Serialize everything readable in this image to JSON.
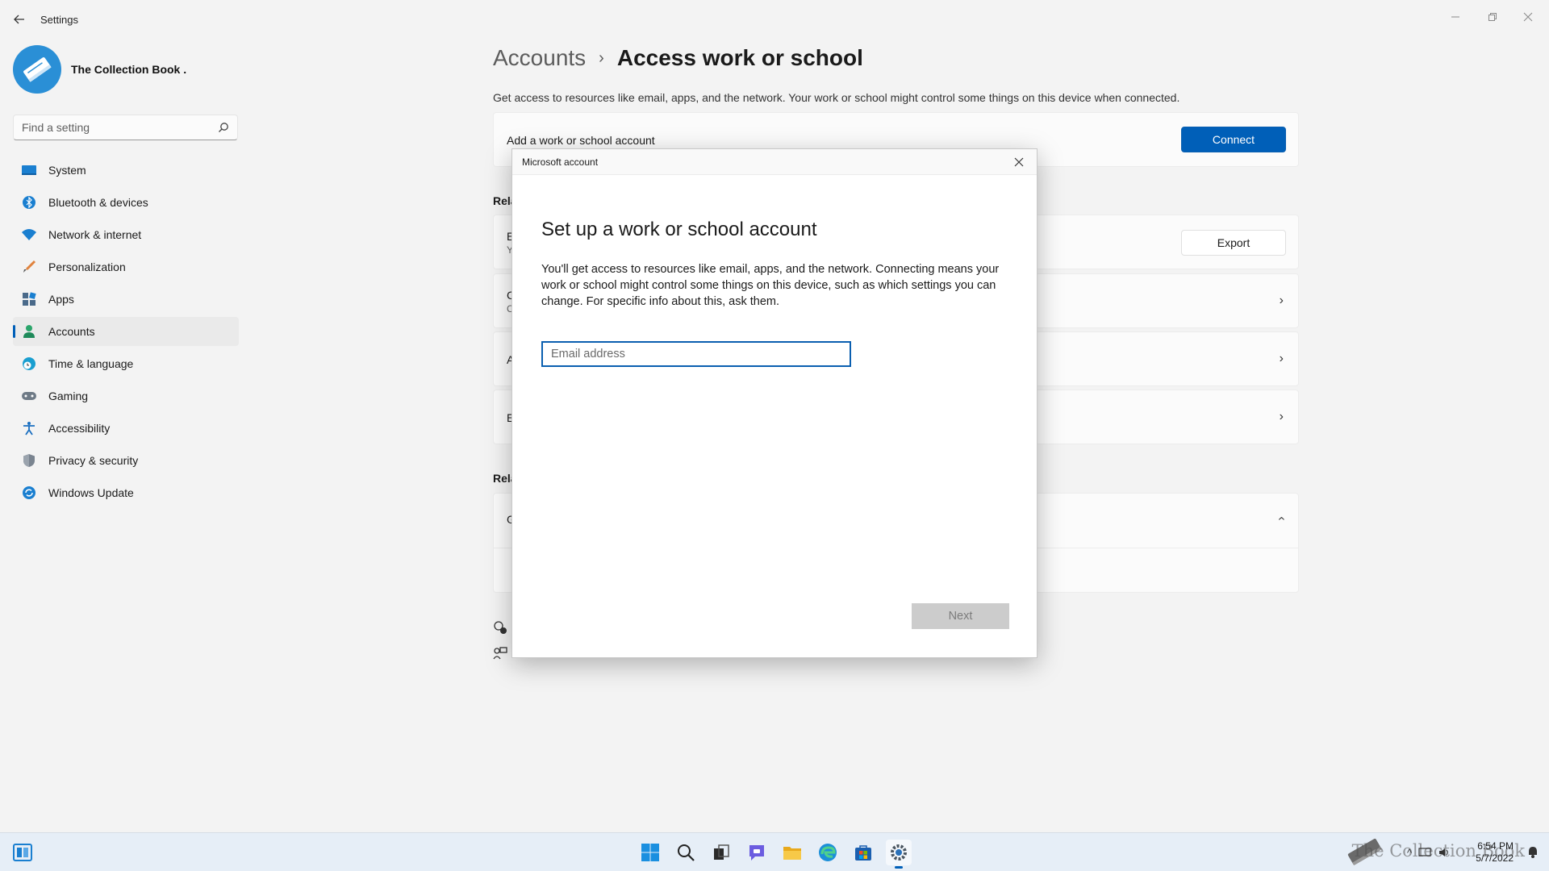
{
  "window": {
    "title": "Settings",
    "controls": [
      "minimize-icon",
      "restore-icon",
      "close-icon"
    ]
  },
  "profile": {
    "name": "The Collection Book ."
  },
  "search": {
    "placeholder": "Find a setting"
  },
  "sidebar": {
    "items": [
      {
        "label": "System",
        "icon": "system-icon"
      },
      {
        "label": "Bluetooth & devices",
        "icon": "bluetooth-icon"
      },
      {
        "label": "Network & internet",
        "icon": "wifi-icon"
      },
      {
        "label": "Personalization",
        "icon": "brush-icon"
      },
      {
        "label": "Apps",
        "icon": "apps-icon"
      },
      {
        "label": "Accounts",
        "icon": "person-icon",
        "active": true
      },
      {
        "label": "Time & language",
        "icon": "globe-clock-icon"
      },
      {
        "label": "Gaming",
        "icon": "gamepad-icon"
      },
      {
        "label": "Accessibility",
        "icon": "accessibility-icon"
      },
      {
        "label": "Privacy & security",
        "icon": "shield-icon"
      },
      {
        "label": "Windows Update",
        "icon": "update-icon"
      }
    ]
  },
  "main": {
    "breadcrumb_parent": "Accounts",
    "breadcrumb_separator": "›",
    "breadcrumb_current": "Access work or school",
    "description": "Get access to resources like email, apps, and the network. Your work or school might control some things on this device when connected.",
    "add_account_label": "Add a work or school account",
    "connect_label": "Connect",
    "related_heading_1": "Rela",
    "row_e_label": "E",
    "row_e_sub": "Y",
    "export_label": "Export",
    "row_c_label": "C",
    "row_c_sub": "C",
    "row_a_label": "A",
    "row_e2_label": "E",
    "related_heading_2": "Rela",
    "row_g_label": "G"
  },
  "dialog": {
    "title": "Microsoft account",
    "heading": "Set up a work or school account",
    "body": "You'll get access to resources like email, apps, and the network. Connecting means your work or school might control some things on this device, such as which settings you can change. For specific info about this, ask them.",
    "email_placeholder": "Email address",
    "next_label": "Next"
  },
  "taskbar": {
    "apps": [
      "start-icon",
      "search-icon",
      "task-view-icon",
      "chat-icon",
      "file-explorer-icon",
      "edge-icon",
      "store-icon",
      "settings-icon"
    ],
    "active_app": "settings-icon",
    "clock_time": "6:54 PM",
    "clock_date": "5/7/2022",
    "watermark": "The Collection Book"
  },
  "colors": {
    "accent": "#005fb8",
    "background": "#f3f3f3",
    "card": "#fbfbfb",
    "taskbar": "#e6eef7"
  }
}
